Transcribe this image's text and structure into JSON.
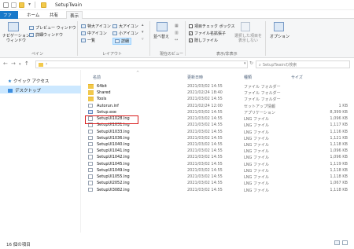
{
  "window": {
    "title": "SetupTwain"
  },
  "tabs": [
    "ファイル",
    "ホーム",
    "共有",
    "表示"
  ],
  "ribbon": {
    "pane_group": {
      "nav_pane": "ナビゲーション\nウィンドウ",
      "preview": "プレビュー ウィンドウ",
      "details": "詳細ウィンドウ",
      "label": "ペイン"
    },
    "layout_group": {
      "items": [
        "特大アイコン",
        "大アイコン",
        "中アイコン",
        "小アイコン",
        "一覧",
        "詳細"
      ],
      "label": "レイアウト"
    },
    "current_view_group": {
      "sort": "並べ替え",
      "label": "現在のビュー"
    },
    "show_hide_group": {
      "item_checkboxes": "項目チェック ボックス",
      "file_extensions": "ファイル名拡張子",
      "hidden_items": "隠しファイル",
      "hide_selected": "選択した項目を\n表示しない",
      "label": "表示/非表示"
    },
    "options": "オプション"
  },
  "address": {
    "search_placeholder": "SetupTwainの検索"
  },
  "nav": {
    "quick_access": "クイック アクセス",
    "desktop": "デスクトップ"
  },
  "columns": {
    "name": "名前",
    "date": "更新日時",
    "type": "種類",
    "size": "サイズ"
  },
  "files": [
    {
      "name": "64bit",
      "date": "2021/03/02 14:55",
      "type": "ファイル フォルダー",
      "size": "",
      "kind": "folder"
    },
    {
      "name": "Shared",
      "date": "2021/02/24 18:40",
      "type": "ファイル フォルダー",
      "size": "",
      "kind": "folder"
    },
    {
      "name": "Tools",
      "date": "2021/03/02 14:55",
      "type": "ファイル フォルダー",
      "size": "",
      "kind": "folder"
    },
    {
      "name": "Autorun.inf",
      "date": "2021/02/24 12:00",
      "type": "セットアップ情報",
      "size": "1 KB",
      "kind": "file"
    },
    {
      "name": "Setup.exe",
      "date": "2021/03/02 14:55",
      "type": "アプリケーション",
      "size": "8,399 KB",
      "kind": "exe"
    },
    {
      "name": "SetupUI1028.lng",
      "date": "2021/03/02 14:55",
      "type": "LNG ファイル",
      "size": "1,096 KB",
      "kind": "file"
    },
    {
      "name": "SetupUI1031.lng",
      "date": "2021/03/02 14:55",
      "type": "LNG ファイル",
      "size": "1,117 KB",
      "kind": "file"
    },
    {
      "name": "SetupUI1033.lng",
      "date": "2021/03/02 14:55",
      "type": "LNG ファイル",
      "size": "1,116 KB",
      "kind": "file"
    },
    {
      "name": "SetupUI1036.lng",
      "date": "2021/03/02 14:55",
      "type": "LNG ファイル",
      "size": "1,121 KB",
      "kind": "file"
    },
    {
      "name": "SetupUI1040.lng",
      "date": "2021/03/02 14:55",
      "type": "LNG ファイル",
      "size": "1,118 KB",
      "kind": "file"
    },
    {
      "name": "SetupUI1041.lng",
      "date": "2021/03/02 14:55",
      "type": "LNG ファイル",
      "size": "1,096 KB",
      "kind": "file"
    },
    {
      "name": "SetupUI1042.lng",
      "date": "2021/03/02 14:55",
      "type": "LNG ファイル",
      "size": "1,096 KB",
      "kind": "file"
    },
    {
      "name": "SetupUI1045.lng",
      "date": "2021/03/02 14:55",
      "type": "LNG ファイル",
      "size": "1,119 KB",
      "kind": "file"
    },
    {
      "name": "SetupUI1049.lng",
      "date": "2021/03/02 14:55",
      "type": "LNG ファイル",
      "size": "1,118 KB",
      "kind": "file"
    },
    {
      "name": "SetupUI1055.lng",
      "date": "2021/03/02 14:55",
      "type": "LNG ファイル",
      "size": "1,118 KB",
      "kind": "file"
    },
    {
      "name": "SetupUI2052.lng",
      "date": "2021/03/02 14:55",
      "type": "LNG ファイル",
      "size": "1,067 KB",
      "kind": "file"
    },
    {
      "name": "SetupUI3082.lng",
      "date": "2021/03/02 14:55",
      "type": "LNG ファイル",
      "size": "1,118 KB",
      "kind": "file"
    }
  ],
  "status": {
    "item_count": "16 個の項目"
  },
  "colors": {
    "file_tab": "#1979ca",
    "highlight": "#d81b1b",
    "nav_selected": "#cce8ff"
  }
}
